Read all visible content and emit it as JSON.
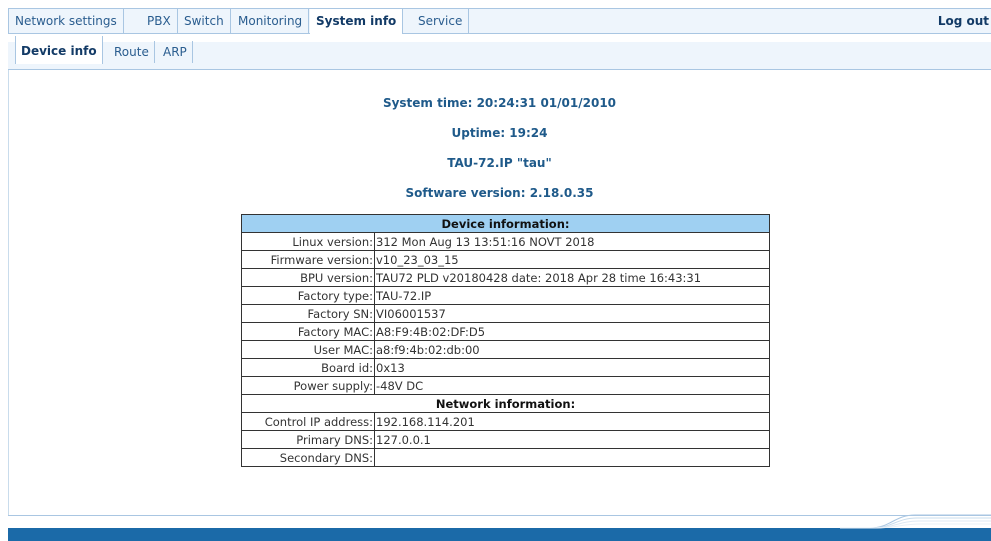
{
  "top_nav": {
    "tabs": [
      {
        "label": "Network settings"
      },
      {
        "label": "PBX"
      },
      {
        "label": "Switch"
      },
      {
        "label": "Monitoring"
      },
      {
        "label": "System info"
      },
      {
        "label": "Service"
      }
    ],
    "active_tab": "System info",
    "logout_label": "Log out"
  },
  "sub_nav": {
    "tabs": [
      {
        "label": "Device info"
      },
      {
        "label": "Route"
      },
      {
        "label": "ARP"
      }
    ],
    "active_tab": "Device info"
  },
  "summary": {
    "system_time": "System time: 20:24:31  01/01/2010",
    "uptime": "Uptime: 19:24",
    "model": "TAU-72.IP \"tau\"",
    "software_version": "Software version: 2.18.0.35"
  },
  "device_table": {
    "header": "Device information:",
    "rows": [
      {
        "key": "Linux version:",
        "value": "312 Mon Aug 13 13:51:16 NOVT 2018"
      },
      {
        "key": "Firmware version:",
        "value": "v10_23_03_15"
      },
      {
        "key": "BPU version:",
        "value": "TAU72 PLD v20180428 date: 2018 Apr 28 time 16:43:31"
      },
      {
        "key": "Factory type:",
        "value": "TAU-72.IP"
      },
      {
        "key": "Factory SN:",
        "value": "VI06001537"
      },
      {
        "key": "Factory MAC:",
        "value": "A8:F9:4B:02:DF:D5"
      },
      {
        "key": "User MAC:",
        "value": "a8:f9:4b:02:db:00"
      },
      {
        "key": "Board id:",
        "value": "0x13"
      },
      {
        "key": "Power supply:",
        "value": "-48V DC"
      }
    ]
  },
  "network_table": {
    "header": "Network information:",
    "rows": [
      {
        "key": "Control IP address:",
        "value": "192.168.114.201"
      },
      {
        "key": "Primary DNS:",
        "value": "127.0.0.1"
      },
      {
        "key": "Secondary DNS:",
        "value": ""
      }
    ]
  },
  "colors": {
    "accent": "#1f5a8a",
    "table_header": "#9fd0f2",
    "footer": "#1b6aa8",
    "nav_background": "#eef5fc"
  }
}
